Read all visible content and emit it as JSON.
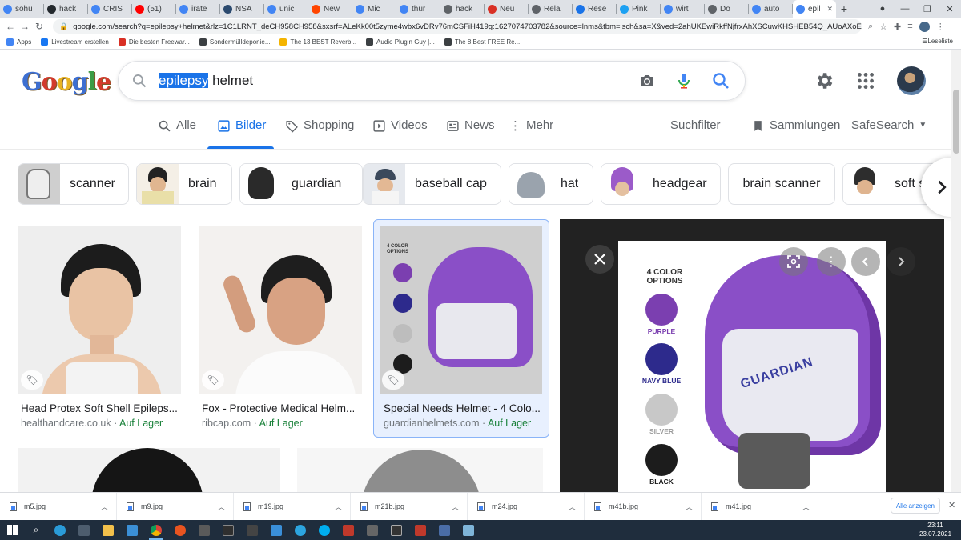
{
  "browser": {
    "tabs": [
      {
        "label": "sohu",
        "icon": "google-icon",
        "color": "#4285f4"
      },
      {
        "label": "hack",
        "icon": "github-icon",
        "color": "#24292e"
      },
      {
        "label": "CRIS",
        "icon": "google-icon",
        "color": "#4285f4"
      },
      {
        "label": "(51)",
        "icon": "youtube-icon",
        "color": "#ff0000"
      },
      {
        "label": "irate",
        "icon": "google-icon",
        "color": "#4285f4"
      },
      {
        "label": "NSA",
        "icon": "nsa-icon",
        "color": "#2b4a6f"
      },
      {
        "label": "unic",
        "icon": "google-icon",
        "color": "#4285f4"
      },
      {
        "label": "New",
        "icon": "reddit-icon",
        "color": "#ff4500"
      },
      {
        "label": "Mic",
        "icon": "google-icon",
        "color": "#4285f4"
      },
      {
        "label": "thur",
        "icon": "google-icon",
        "color": "#4285f4"
      },
      {
        "label": "hack",
        "icon": "web-icon",
        "color": "#5f6368"
      },
      {
        "label": "Neu",
        "icon": "z-icon",
        "color": "#d93025"
      },
      {
        "label": "Rela",
        "icon": "drop-icon",
        "color": "#5f6368"
      },
      {
        "label": "Rese",
        "icon": "research-icon",
        "color": "#1a73e8"
      },
      {
        "label": "Pink",
        "icon": "twitter-icon",
        "color": "#1da1f2"
      },
      {
        "label": "wirt",
        "icon": "google-icon",
        "color": "#4285f4"
      },
      {
        "label": "Do",
        "icon": "web-icon",
        "color": "#5f6368"
      },
      {
        "label": "auto",
        "icon": "google-icon",
        "color": "#4285f4"
      },
      {
        "label": "epil",
        "icon": "google-icon",
        "color": "#4285f4",
        "active": true
      }
    ],
    "new_tab": "+",
    "url": "google.com/search?q=epilepsy+helmet&rlz=1C1LRNT_deCH958CH958&sxsrf=ALeKk00t5zyme4wbx6vDRv76mCSFiH419g:1627074703782&source=lnms&tbm=isch&sa=X&ved=2ahUKEwiRkffNjfrxAhXSCuwKHSHEB54Q_AUoAXoECAEQAw&biw=1097&bih=...",
    "bookmarks": [
      {
        "label": "Apps",
        "icon": "apps-icon"
      },
      {
        "label": "Livestream erstellen",
        "icon": "facebook-icon"
      },
      {
        "label": "Die besten Freewar...",
        "icon": "star-icon"
      },
      {
        "label": "Sondermülldeponie...",
        "icon": "w-icon"
      },
      {
        "label": "The 13 BEST Reverb...",
        "icon": "bookmark-icon"
      },
      {
        "label": "Audio Plugin Guy |...",
        "icon": "bookmark-icon"
      },
      {
        "label": "The 8 Best FREE Re...",
        "icon": "bookmark-icon"
      }
    ],
    "reading_list": "Leseliste"
  },
  "search": {
    "query_selected": "epilepsy",
    "query_rest": " helmet"
  },
  "nav": {
    "tabs": [
      {
        "label": "Alle",
        "icon": "search-icon"
      },
      {
        "label": "Bilder",
        "icon": "image-icon",
        "active": true
      },
      {
        "label": "Shopping",
        "icon": "tag-icon"
      },
      {
        "label": "Videos",
        "icon": "play-icon"
      },
      {
        "label": "News",
        "icon": "news-icon"
      },
      {
        "label": "Mehr",
        "icon": "more-icon"
      }
    ],
    "filter": "Suchfilter",
    "collections": "Sammlungen",
    "safesearch": "SafeSearch"
  },
  "chips": [
    {
      "label": "scanner"
    },
    {
      "label": "brain"
    },
    {
      "label": "guardian"
    },
    {
      "label": "baseball cap"
    },
    {
      "label": "hat"
    },
    {
      "label": "headgear"
    },
    {
      "label": "brain scanner"
    },
    {
      "label": "soft s"
    }
  ],
  "results": [
    {
      "title": "Head Protex Soft Shell Epileps...",
      "site": "healthandcare.co.uk",
      "sep": " · ",
      "stock": "Auf Lager"
    },
    {
      "title": "Fox - Protective Medical Helm...",
      "site": "ribcap.com",
      "sep": " · ",
      "stock": "Auf Lager"
    },
    {
      "title": "Special Needs Helmet - 4 Colo...",
      "site": "guardianhelmets.com",
      "sep": " · ",
      "stock": "Auf Lager"
    }
  ],
  "thumb_overlay": {
    "heading": "4 COLOR OPTIONS",
    "colors": [
      "PURPLE",
      "NAVY BLUE",
      "SILVER",
      "BLACK"
    ]
  },
  "preview": {
    "heading": "4 COLOR OPTIONS",
    "swatches": [
      {
        "label": "PURPLE",
        "color": "#7b3fb0",
        "text_color": "#7b3fb0"
      },
      {
        "label": "NAVY BLUE",
        "color": "#2d2a8c",
        "text_color": "#2d2a8c"
      },
      {
        "label": "SILVER",
        "color": "#c8c8c8",
        "text_color": "#9a9a9a"
      },
      {
        "label": "BLACK",
        "color": "#1c1c1c",
        "text_color": "#1c1c1c"
      }
    ],
    "brand_text": "GUARDIAN"
  },
  "downloads": [
    {
      "name": "m5.jpg"
    },
    {
      "name": "m9.jpg"
    },
    {
      "name": "m19.jpg"
    },
    {
      "name": "m21b.jpg"
    },
    {
      "name": "m24.jpg"
    },
    {
      "name": "m41b.jpg"
    },
    {
      "name": "m41.jpg"
    }
  ],
  "downloads_show_all": "Alle anzeigen",
  "clock": {
    "time": "23:11",
    "date": "23.07.2021"
  },
  "colors": {
    "accent": "#1a73e8",
    "stock_green": "#188038",
    "helmet_purple": "#8a4fc7"
  }
}
